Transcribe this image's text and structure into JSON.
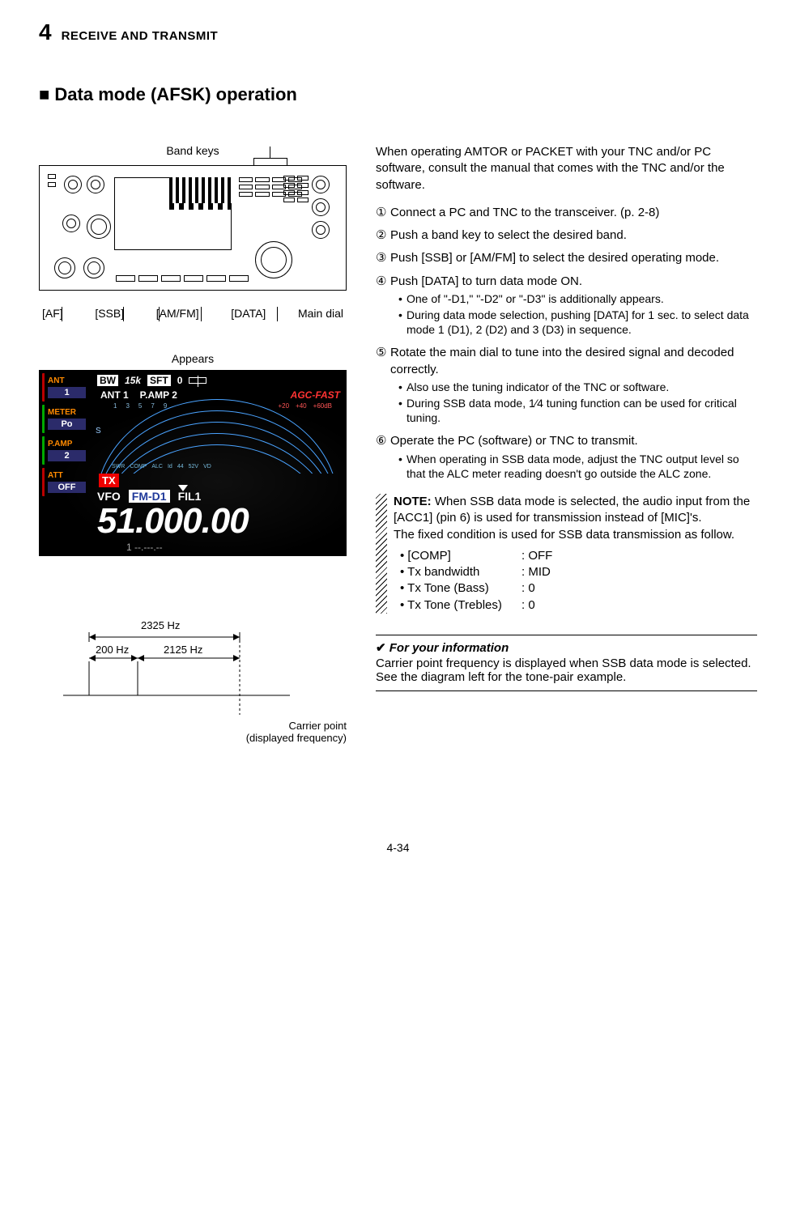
{
  "chapter": {
    "number": "4",
    "title": "RECEIVE AND TRANSMIT"
  },
  "section_title": "■ Data mode (AFSK) operation",
  "labels": {
    "band_keys": "Band keys",
    "af": "[AF]",
    "ssb": "[SSB]",
    "amfm": "[AM/FM]",
    "data": "[DATA]",
    "main_dial": "Main dial",
    "appears": "Appears"
  },
  "display": {
    "side": {
      "ant_label": "ANT",
      "ant_val": "1",
      "meter_label": "METER",
      "meter_val": "Po",
      "pamp_label": "P.AMP",
      "pamp_val": "2",
      "att_label": "ATT",
      "att_val": "OFF"
    },
    "top": {
      "bw": "BW",
      "bw_val": "15k",
      "sft": "SFT",
      "sft_val": "0"
    },
    "antline": {
      "ant": "ANT 1",
      "pamp": "P.AMP 2"
    },
    "agc": "AGC-FAST",
    "scale_left": [
      "1",
      "3",
      "5",
      "7",
      "9"
    ],
    "scale_right": [
      "+20",
      "+40",
      "+60dB"
    ],
    "meter_small": [
      "SWR",
      "COMP",
      "ALC",
      "Id",
      "44",
      "52V",
      "VD"
    ],
    "tx": "TX",
    "vfo": "VFO",
    "mode": "FM-D1",
    "fil": "FIL1",
    "frequency": "51.000.00",
    "sub_band": "1   --.---.--"
  },
  "tone_diagram": {
    "total": "2325 Hz",
    "shift": "200 Hz",
    "space": "2125 Hz",
    "caption1": "Carrier point",
    "caption2": "(displayed frequency)"
  },
  "intro": "When  operating  AMTOR  or  PACKET  with  your  TNC and/or  PC  software,  consult  the  manual  that  comes with the TNC and/or the software.",
  "steps": [
    {
      "n": "①",
      "text": "Connect a PC and TNC to the transceiver. (p. 2-8)"
    },
    {
      "n": "②",
      "text": "Push a band key to select the desired band."
    },
    {
      "n": "③",
      "text": "Push [SSB] or [AM/FM] to select the desired operating mode."
    },
    {
      "n": "④",
      "text": "Push [DATA] to turn data mode ON.",
      "subs": [
        "One of \"-D1,\" \"-D2\" or \"-D3\" is additionally appears.",
        "During data mode selection, pushing [DATA] for 1 sec. to select data mode 1 (D1), 2 (D2) and 3 (D3) in sequence."
      ]
    },
    {
      "n": "⑤",
      "text": "Rotate the main dial to tune into the desired signal and decoded correctly.",
      "subs": [
        "Also use the tuning indicator of the TNC or software.",
        "During SSB data mode, 1⁄4 tuning function can be used for critical tuning."
      ]
    },
    {
      "n": "⑥",
      "text": "Operate the PC (software) or TNC to transmit.",
      "subs": [
        "When operating in SSB data mode, adjust the TNC output level so that the ALC meter reading doesn't go outside the ALC zone."
      ]
    }
  ],
  "note": {
    "label": "NOTE:",
    "body1": "When SSB data mode is selected, the audio input from the [ACC1] (pin 6) is used for transmission instead of [MIC]'s.",
    "body2": "The fixed condition is used for SSB data transmission as follow.",
    "settings": [
      {
        "k": "[COMP]",
        "v": ": OFF"
      },
      {
        "k": "Tx bandwidth",
        "v": ": MID"
      },
      {
        "k": "Tx Tone (Bass)",
        "v": ": 0"
      },
      {
        "k": "Tx Tone (Trebles)",
        "v": ": 0"
      }
    ]
  },
  "info": {
    "title": "For your information",
    "line1": "Carrier  point  frequency  is  displayed  when  SSB  data mode is selected.",
    "line2": "See the diagram left for the tone-pair example."
  },
  "page_footer": "4-34"
}
